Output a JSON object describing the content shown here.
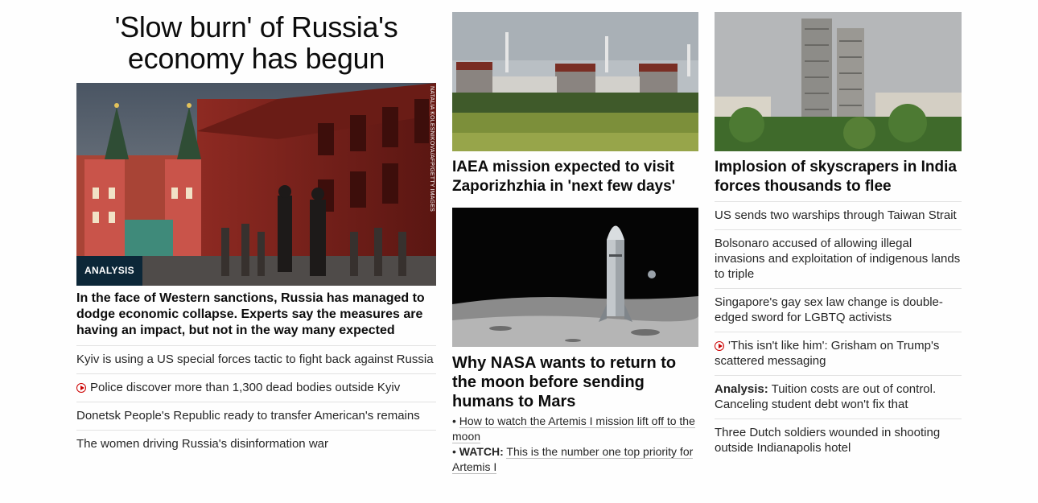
{
  "lead": {
    "title": "'Slow burn' of Russia's economy has begun",
    "badge": "ANALYSIS",
    "photo_credit": "NATALIA KOLESNIKOVA/AFP/GETTY IMAGES",
    "summary": "In the face of Western sanctions, Russia has managed to dodge economic collapse. Experts say the measures are having an impact, but not in the way many expected",
    "links": [
      {
        "text": "Kyiv is using a US special forces tactic to fight back against Russia",
        "video": false
      },
      {
        "text": "Police discover more than 1,300 dead bodies outside Kyiv",
        "video": true
      },
      {
        "text": "Donetsk People's Republic ready to transfer American's remains",
        "video": false
      },
      {
        "text": "The women driving Russia's disinformation war",
        "video": false
      }
    ]
  },
  "middle": {
    "story1_title": "IAEA mission expected to visit Zaporizhzhia in 'next few days'",
    "story2_title": "Why NASA wants to return to the moon before sending humans to Mars",
    "sub1": "How to watch the Artemis I mission lift off to the moon",
    "sub2_prefix": "WATCH:",
    "sub2": "This is the number one top priority for Artemis I"
  },
  "right": {
    "story_title": "Implosion of skyscrapers in India forces thousands to flee",
    "links": [
      {
        "prefix": "",
        "text": "US sends two warships through Taiwan Strait",
        "video": false
      },
      {
        "prefix": "",
        "text": "Bolsonaro accused of allowing illegal invasions and exploitation of indigenous lands to triple",
        "video": false
      },
      {
        "prefix": "",
        "text": "Singapore's gay sex law change is double-edged sword for LGBTQ activists",
        "video": false
      },
      {
        "prefix": "",
        "text": "'This isn't like him': Grisham on Trump's scattered messaging",
        "video": true
      },
      {
        "prefix": "Analysis:",
        "text": "Tuition costs are out of control. Canceling student debt won't fix that",
        "video": false
      },
      {
        "prefix": "",
        "text": "Three Dutch soldiers wounded in shooting outside Indianapolis hotel",
        "video": false
      }
    ]
  },
  "colors": {
    "badge_bg": "#0c2738",
    "video_icon": "#cc0000",
    "divider": "#e2e2e2"
  },
  "icons": {
    "video": "play-circle-icon"
  }
}
